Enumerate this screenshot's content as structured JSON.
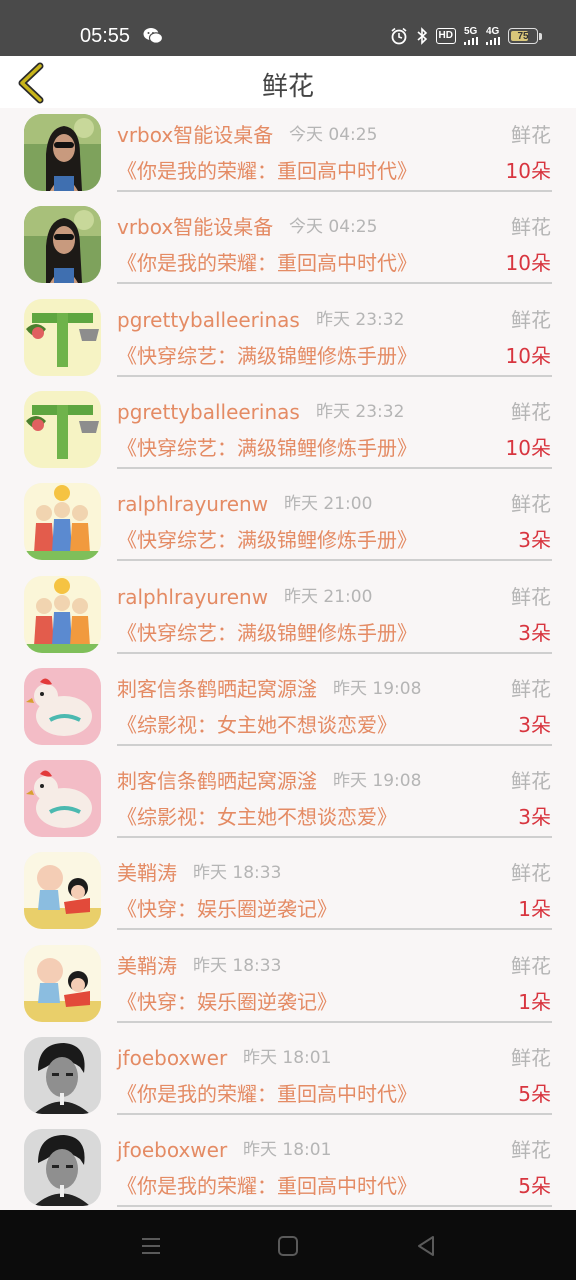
{
  "status_bar": {
    "time": "05:55",
    "hd": "HD",
    "net1": "5G",
    "net2": "4G",
    "battery": "75",
    "battery_level": 0.75
  },
  "header": {
    "title": "鲜花"
  },
  "rows": [
    {
      "user": "vrbox智能设桌备",
      "time": "今天 04:25",
      "type": "鲜花",
      "book": "《你是我的荣耀：重回高中时代》",
      "count": "10朵",
      "avatar": "woman-photo"
    },
    {
      "user": "vrbox智能设桌备",
      "time": "今天 04:25",
      "type": "鲜花",
      "book": "《你是我的荣耀：重回高中时代》",
      "count": "10朵",
      "avatar": "woman-photo"
    },
    {
      "user": "pgrettyballeerinas",
      "time": "昨天 23:32",
      "type": "鲜花",
      "book": "《快穿综艺：满级锦鲤修炼手册》",
      "count": "10朵",
      "avatar": "letter-t"
    },
    {
      "user": "pgrettyballeerinas",
      "time": "昨天 23:32",
      "type": "鲜花",
      "book": "《快穿综艺：满级锦鲤修炼手册》",
      "count": "10朵",
      "avatar": "letter-t"
    },
    {
      "user": "ralphlrayurenw",
      "time": "昨天 21:00",
      "type": "鲜花",
      "book": "《快穿综艺：满级锦鲤修炼手册》",
      "count": "3朵",
      "avatar": "family-cartoon"
    },
    {
      "user": "ralphlrayurenw",
      "time": "昨天 21:00",
      "type": "鲜花",
      "book": "《快穿综艺：满级锦鲤修炼手册》",
      "count": "3朵",
      "avatar": "family-cartoon"
    },
    {
      "user": "刺客信条鹤晒起窝源滏",
      "time": "昨天 19:08",
      "type": "鲜花",
      "book": "《综影视：女主她不想谈恋爱》",
      "count": "3朵",
      "avatar": "chicken"
    },
    {
      "user": "刺客信条鹤晒起窝源滏",
      "time": "昨天 19:08",
      "type": "鲜花",
      "book": "《综影视：女主她不想谈恋爱》",
      "count": "3朵",
      "avatar": "chicken"
    },
    {
      "user": "美鞘涛",
      "time": "昨天 18:33",
      "type": "鲜花",
      "book": "《快穿：娱乐圈逆袭记》",
      "count": "1朵",
      "avatar": "kids-cartoon"
    },
    {
      "user": "美鞘涛",
      "time": "昨天 18:33",
      "type": "鲜花",
      "book": "《快穿：娱乐圈逆袭记》",
      "count": "1朵",
      "avatar": "kids-cartoon"
    },
    {
      "user": "jfoeboxwer",
      "time": "昨天 18:01",
      "type": "鲜花",
      "book": "《你是我的荣耀：重回高中时代》",
      "count": "5朵",
      "avatar": "man-bw-photo"
    },
    {
      "user": "jfoeboxwer",
      "time": "昨天 18:01",
      "type": "鲜花",
      "book": "《你是我的荣耀：重回高中时代》",
      "count": "5朵",
      "avatar": "man-bw-photo"
    }
  ],
  "colors": {
    "accent": "#e48b64",
    "count": "#d8353f",
    "muted": "#b5b5b5",
    "back_arrow": "#8a7a10"
  }
}
